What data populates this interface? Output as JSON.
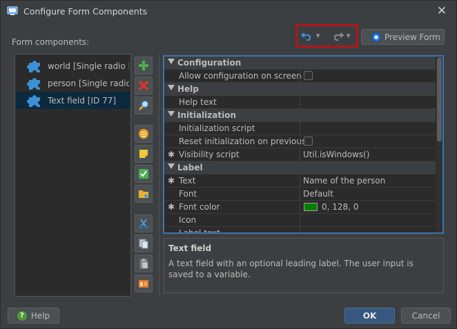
{
  "window": {
    "title": "Configure Form Components"
  },
  "left": {
    "label": "Form components:",
    "items": [
      {
        "label": "world [Single radio button]",
        "selected": false
      },
      {
        "label": "person [Single radio button]",
        "selected": false
      },
      {
        "label": "Text field [ID 77]",
        "selected": true
      }
    ]
  },
  "toolbar": {
    "preview_label": "Preview Form"
  },
  "properties": {
    "rows": [
      {
        "type": "category",
        "name": "Configuration"
      },
      {
        "type": "prop",
        "name": "Allow configuration on screen",
        "value_type": "checkbox",
        "checked": false,
        "star": false
      },
      {
        "type": "category",
        "name": "Help"
      },
      {
        "type": "prop",
        "name": "Help text",
        "value": "",
        "star": false
      },
      {
        "type": "category",
        "name": "Initialization"
      },
      {
        "type": "prop",
        "name": "Initialization script",
        "value": "",
        "star": false
      },
      {
        "type": "prop",
        "name": "Reset initialization on previous",
        "value_type": "checkbox",
        "checked": false,
        "star": false
      },
      {
        "type": "prop",
        "name": "Visibility script",
        "value": "Util.isWindows()",
        "star": true
      },
      {
        "type": "category",
        "name": "Label"
      },
      {
        "type": "prop",
        "name": "Text",
        "value": "Name of the person",
        "star": true
      },
      {
        "type": "prop",
        "name": "Font",
        "value": "Default",
        "star": false
      },
      {
        "type": "prop",
        "name": "Font color",
        "value_type": "color",
        "color": "#008000",
        "value": "0, 128, 0",
        "star": true
      },
      {
        "type": "prop",
        "name": "Icon",
        "value": "",
        "star": false
      },
      {
        "type": "prop",
        "name": "Label text",
        "value": "",
        "star": false
      }
    ]
  },
  "description": {
    "title": "Text field",
    "text": "A text field with an optional leading label. The user input is saved to a variable."
  },
  "footer": {
    "help_label": "Help",
    "ok_label": "OK",
    "cancel_label": "Cancel"
  },
  "colors": {
    "accent": "#365880",
    "highlight_box": "#b5141a",
    "focus_border": "#3e72b0",
    "selection": "#0d293e"
  }
}
